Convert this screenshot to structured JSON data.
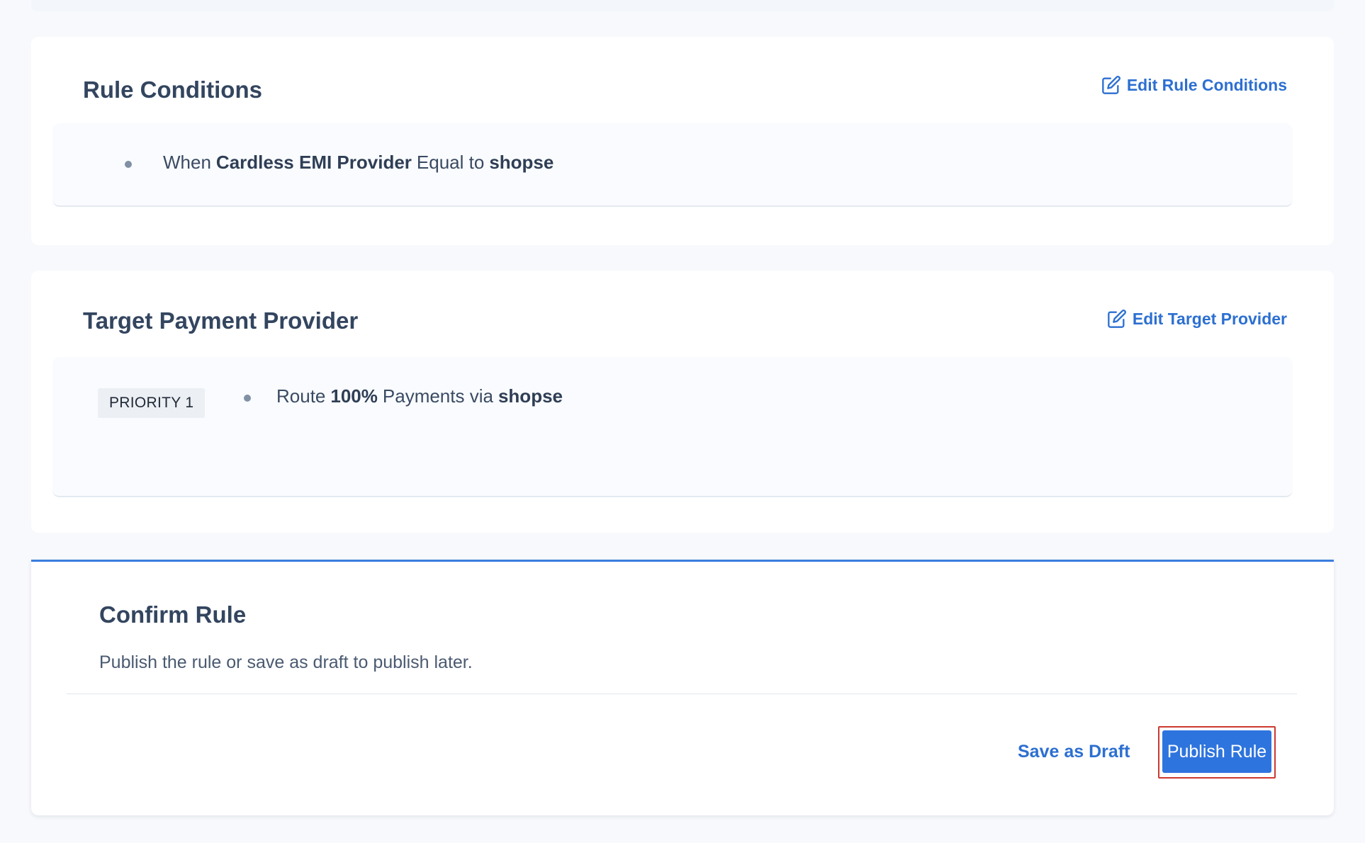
{
  "rule_conditions": {
    "title": "Rule Conditions",
    "edit_label": "Edit Rule Conditions",
    "edit_icon": "edit-icon",
    "condition": {
      "prefix": "When",
      "field": "Cardless EMI Provider",
      "operator": "Equal to",
      "value": "shopse"
    }
  },
  "target_provider": {
    "title": "Target Payment Provider",
    "edit_label": "Edit Target Provider",
    "edit_icon": "edit-icon",
    "priority_label": "PRIORITY 1",
    "route": {
      "prefix": "Route",
      "percent": "100%",
      "middle": "Payments via",
      "provider": "shopse"
    }
  },
  "confirm": {
    "title": "Confirm Rule",
    "subtitle": "Publish the rule or save as draft to publish later.",
    "draft_label": "Save as Draft",
    "publish_label": "Publish Rule"
  },
  "colors": {
    "accent": "#2c6fd1",
    "primary_button": "#2e74de",
    "highlight_outline": "#cc3a2f",
    "confirm_top_border": "#3b7ddd"
  }
}
